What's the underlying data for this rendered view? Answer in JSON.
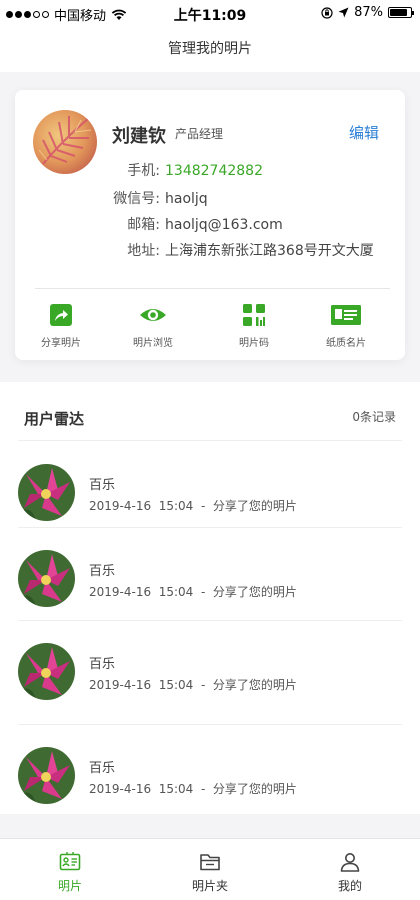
{
  "status_bar": {
    "carrier": "中国移动",
    "time": "上午11:09",
    "battery": "87%",
    "battery_level": 0.87
  },
  "nav": {
    "title": "管理我的明片"
  },
  "card": {
    "name": "刘建钦",
    "job_title": "产品经理",
    "edit_label": "编辑",
    "phone_label": "手机:",
    "phone": "13482742882",
    "wechat_label": "微信号:",
    "wechat": "haoljq",
    "email_label": "邮箱:",
    "email": "haoljq@163.com",
    "address_label": "地址:",
    "address": "上海浦东新张江路368号开文大厦",
    "actions": [
      {
        "label": "分享明片",
        "icon": "share-icon"
      },
      {
        "label": "明片浏览",
        "icon": "eye-icon"
      },
      {
        "label": "明片码",
        "icon": "qr-code-icon"
      },
      {
        "label": "纸质名片",
        "icon": "paper-card-icon"
      }
    ]
  },
  "radar": {
    "title": "用户雷达",
    "count": "0条记录",
    "items": [
      {
        "name": "百乐",
        "detail": "2019-4-16  15:04  -  分享了您的明片"
      },
      {
        "name": "百乐",
        "detail": "2019-4-16  15:04  -  分享了您的明片"
      },
      {
        "name": "百乐",
        "detail": "2019-4-16  15:04  -  分享了您的明片"
      },
      {
        "name": "百乐",
        "detail": "2019-4-16  15:04  -  分享了您的明片"
      }
    ]
  },
  "tabs": [
    {
      "label": "明片",
      "icon": "card-icon",
      "active": true
    },
    {
      "label": "明片夹",
      "icon": "folder-icon",
      "active": false
    },
    {
      "label": "我的",
      "icon": "user-icon",
      "active": false
    }
  ],
  "colors": {
    "accent_green": "#3aa827",
    "link_blue": "#2c7fd6"
  }
}
